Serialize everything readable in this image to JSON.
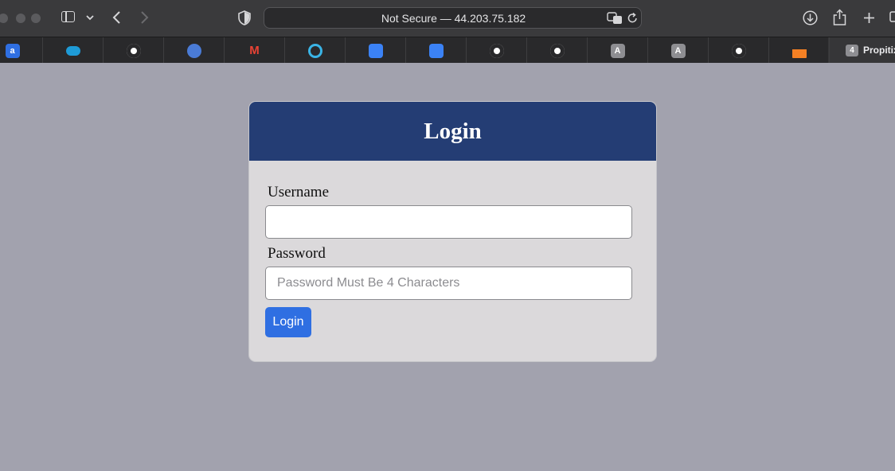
{
  "browser": {
    "address": "Not Secure — 44.203.75.182",
    "tabs": [
      {
        "icon": "amazon-a-icon",
        "glyph": "a",
        "color": "#2f6fe2"
      },
      {
        "icon": "salesforce-cloud-icon",
        "glyph": "",
        "color": "#1e9bd7"
      },
      {
        "icon": "github-icon",
        "glyph": "",
        "color": "#ffffff"
      },
      {
        "icon": "globe-icon",
        "glyph": "",
        "color": "#4a7bd6"
      },
      {
        "icon": "gmail-icon",
        "glyph": "M",
        "color": "#ea4335"
      },
      {
        "icon": "circle-icon",
        "glyph": "",
        "color": "#3ab4e6"
      },
      {
        "icon": "app-icon",
        "glyph": "",
        "color": "#3b82f6"
      },
      {
        "icon": "app-icon",
        "glyph": "",
        "color": "#3b82f6"
      },
      {
        "icon": "github-icon",
        "glyph": "",
        "color": "#ffffff"
      },
      {
        "icon": "github-icon",
        "glyph": "",
        "color": "#ffffff"
      },
      {
        "icon": "letter-a-icon",
        "glyph": "A",
        "color": "#8e8e92"
      },
      {
        "icon": "letter-a-icon",
        "glyph": "A",
        "color": "#8e8e92"
      },
      {
        "icon": "github-icon",
        "glyph": "",
        "color": "#ffffff"
      },
      {
        "icon": "stackoverflow-icon",
        "glyph": "",
        "color": "#f48024"
      }
    ],
    "last_tab": {
      "count": "4",
      "title": "Propitix."
    }
  },
  "login": {
    "title": "Login",
    "username_label": "Username",
    "username_value": "",
    "password_label": "Password",
    "password_placeholder": "Password Must Be 4 Characters",
    "submit_label": "Login"
  }
}
